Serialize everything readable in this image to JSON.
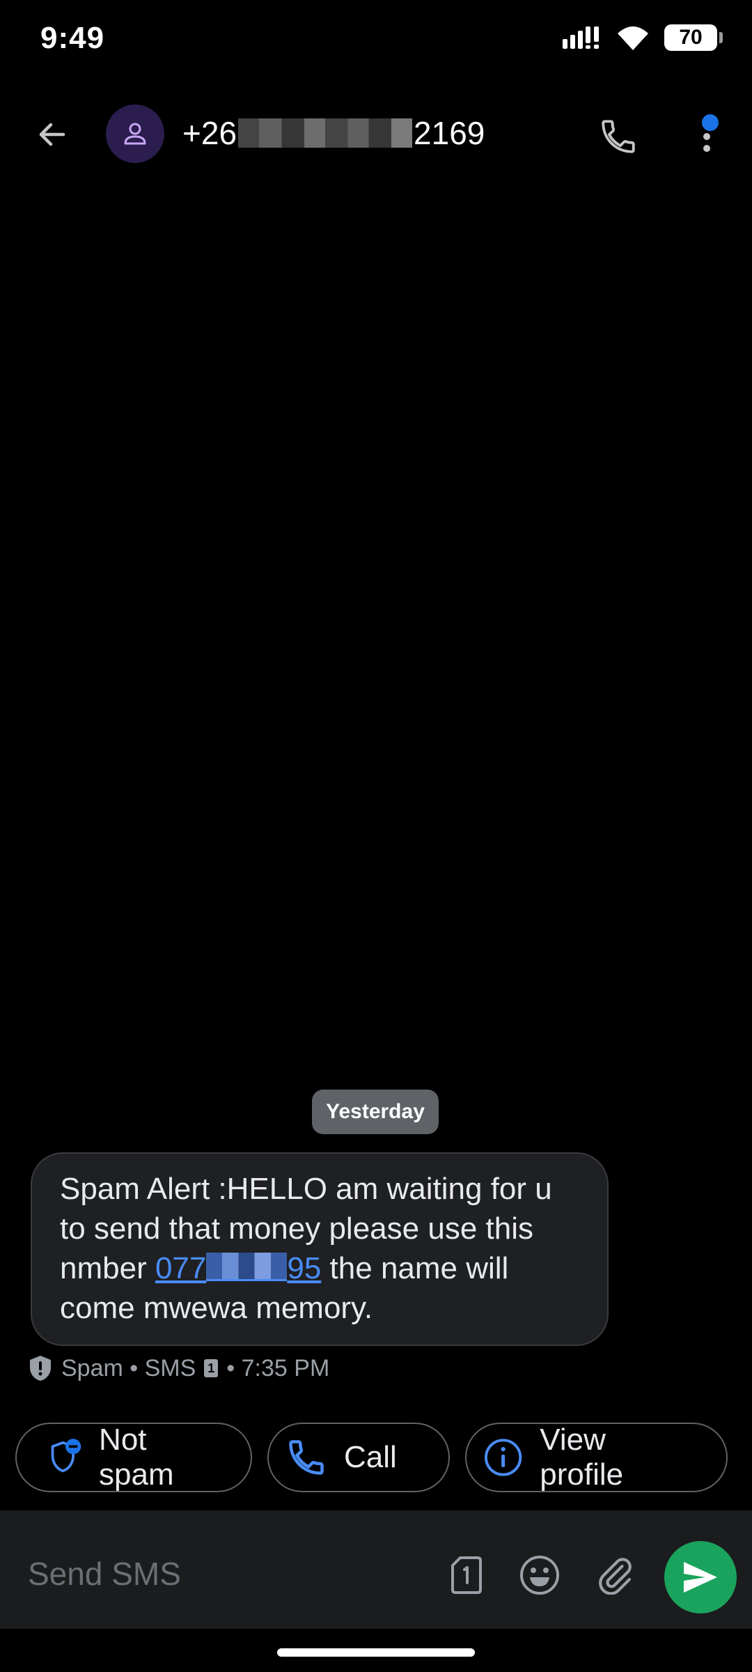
{
  "status_bar": {
    "time": "9:49",
    "battery": "70"
  },
  "header": {
    "contact_prefix": "+26",
    "contact_suffix": "2169"
  },
  "conversation": {
    "date_chip": "Yesterday",
    "message": {
      "part1": "Spam Alert :HELLO am waiting for u to send that money please use this nmber ",
      "link_prefix": "077",
      "link_suffix": "95",
      "part2": " the name will come mwewa memory."
    },
    "meta": {
      "label": "Spam • SMS",
      "sim": "1",
      "time": "• 7:35 PM"
    }
  },
  "actions": {
    "not_spam": "Not spam",
    "call": "Call",
    "view_profile": "View profile"
  },
  "compose": {
    "placeholder": "Send SMS"
  },
  "colors": {
    "send": "#1aa35c",
    "link": "#4a8cf7",
    "accent": "#1a73e8"
  }
}
